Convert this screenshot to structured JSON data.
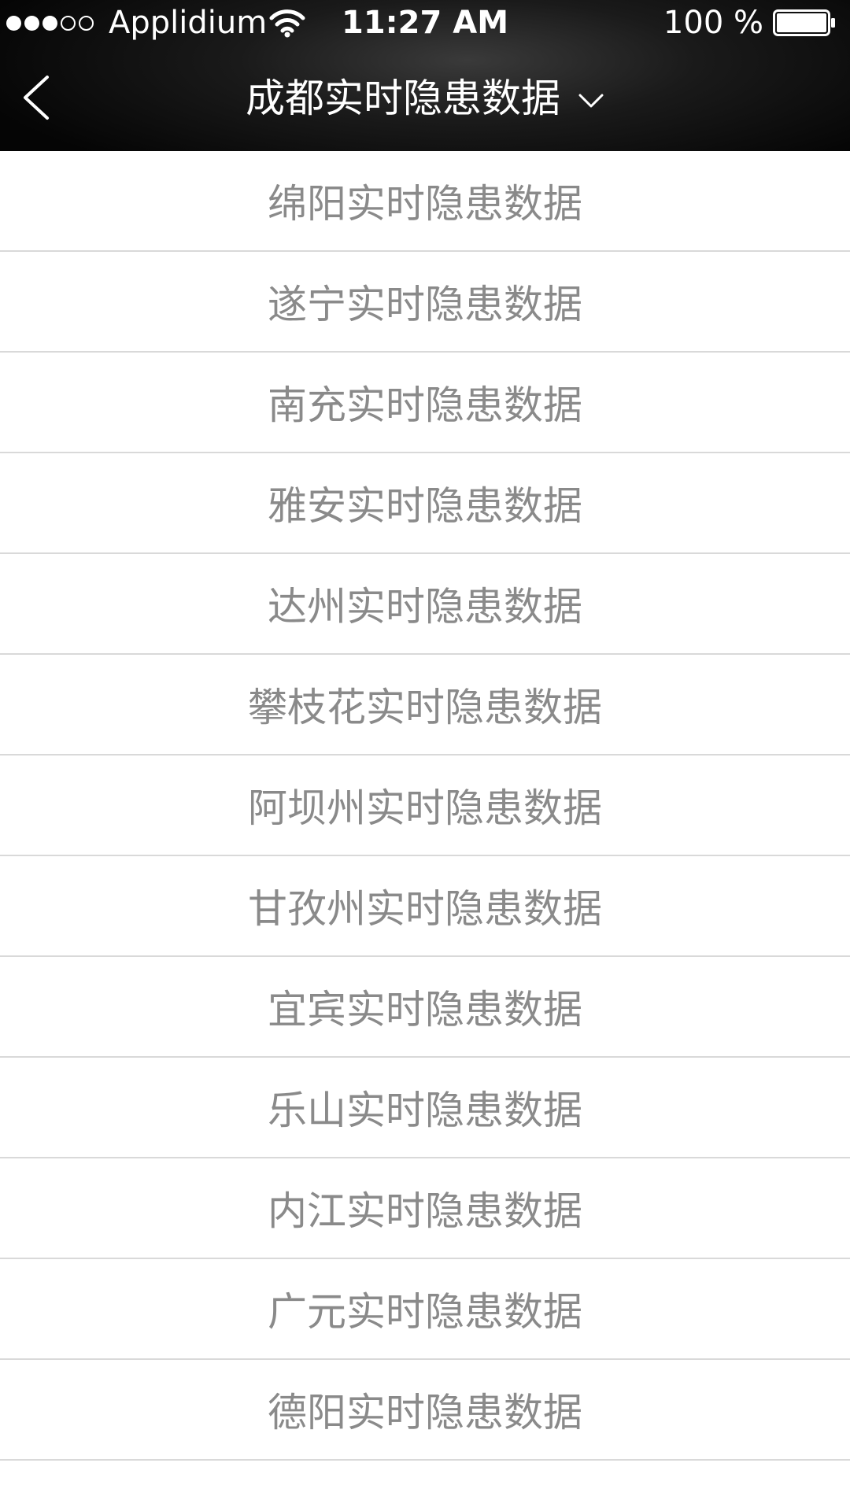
{
  "status_bar": {
    "carrier": "Applidium",
    "time": "11:27 AM",
    "battery_percent": "100 %",
    "signal_bars_filled": 3,
    "signal_bars_total": 5,
    "battery_level": 1.0
  },
  "nav": {
    "back_icon": "chevron-left-icon",
    "title": "成都实时隐患数据",
    "dropdown_icon": "chevron-down-icon"
  },
  "items": [
    {
      "label": "绵阳实时隐患数据"
    },
    {
      "label": "遂宁实时隐患数据"
    },
    {
      "label": "南充实时隐患数据"
    },
    {
      "label": "雅安实时隐患数据"
    },
    {
      "label": "达州实时隐患数据"
    },
    {
      "label": "攀枝花实时隐患数据"
    },
    {
      "label": "阿坝州实时隐患数据"
    },
    {
      "label": "甘孜州实时隐患数据"
    },
    {
      "label": "宜宾实时隐患数据"
    },
    {
      "label": "乐山实时隐患数据"
    },
    {
      "label": "内江实时隐患数据"
    },
    {
      "label": "广元实时隐患数据"
    },
    {
      "label": "德阳实时隐患数据"
    }
  ],
  "colors": {
    "header_bg": "#050505",
    "list_text": "#8a8a8a",
    "divider": "#d9d9d9"
  }
}
